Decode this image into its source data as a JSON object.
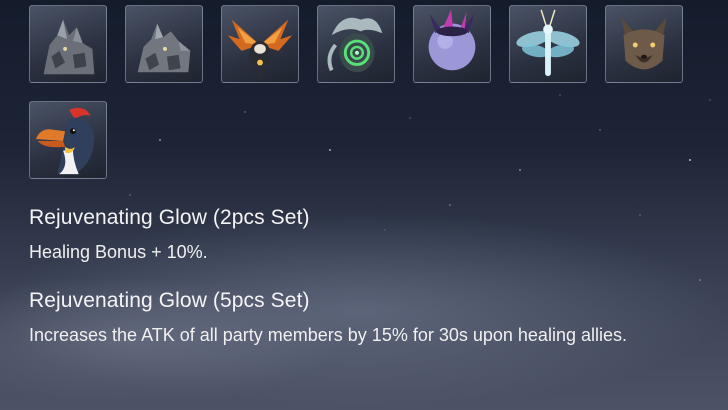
{
  "creatures": [
    {
      "icon": "gray-rock-beast-icon"
    },
    {
      "icon": "gray-rock-beast-variant-icon"
    },
    {
      "icon": "flame-winged-beast-icon"
    },
    {
      "icon": "green-spiral-spirit-icon"
    },
    {
      "icon": "purple-horned-orb-icon"
    },
    {
      "icon": "blue-dragonfly-icon"
    },
    {
      "icon": "brown-wolf-icon"
    },
    {
      "icon": "red-crested-bird-icon"
    }
  ],
  "sets": [
    {
      "title": "Rejuvenating Glow (2pcs Set)",
      "description": "Healing Bonus + 10%."
    },
    {
      "title": "Rejuvenating Glow (5pcs Set)",
      "description": "Increases the ATK of all party members by 15% for 30s upon healing allies."
    }
  ]
}
